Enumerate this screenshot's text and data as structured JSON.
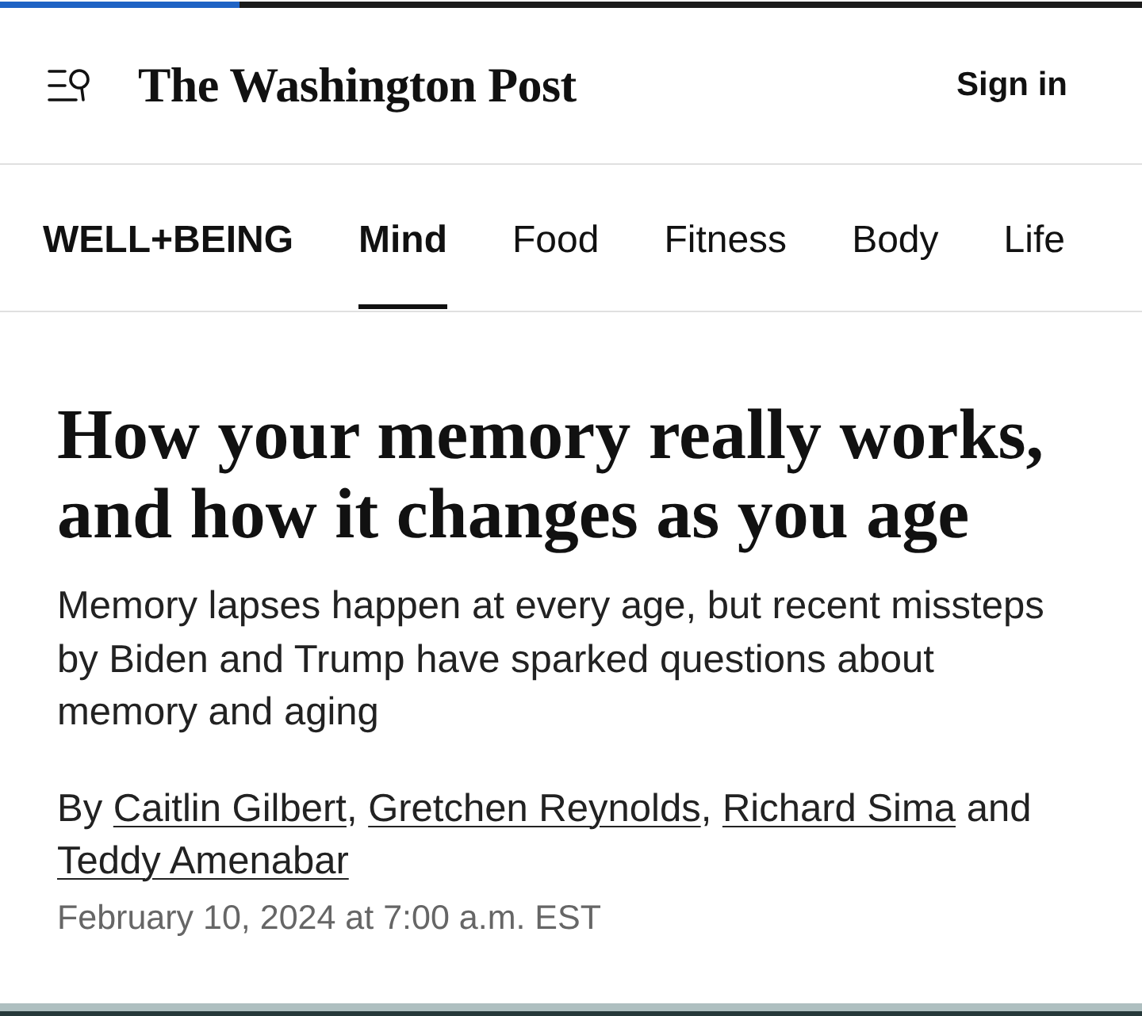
{
  "progress_bar": {
    "level": 0.21
  },
  "header": {
    "logo": "The Washington Post",
    "sign_in": "Sign in"
  },
  "section_nav": {
    "section": "WELL+BEING",
    "tabs": [
      {
        "label": "Mind",
        "selected": true
      },
      {
        "label": "Food",
        "selected": false
      },
      {
        "label": "Fitness",
        "selected": false
      },
      {
        "label": "Body",
        "selected": false
      },
      {
        "label": "Life",
        "selected": false
      }
    ]
  },
  "article": {
    "headline": "How your memory really works, and how it changes as you age",
    "subheadline": "Memory lapses happen at every age, but recent missteps by Biden and Trump have sparked questions about memory and aging",
    "byline": [
      {
        "kind": "text",
        "text": "By "
      },
      {
        "kind": "link",
        "text": "Caitlin Gilbert"
      },
      {
        "kind": "text",
        "text": ", "
      },
      {
        "kind": "link",
        "text": "Gretchen Reynolds"
      },
      {
        "kind": "text",
        "text": ", "
      },
      {
        "kind": "link",
        "text": "Richard Sima"
      },
      {
        "kind": "text",
        "text": " and "
      },
      {
        "kind": "link",
        "text": "Teddy Amenabar"
      }
    ],
    "date": "February 10, 2024 at 7:00 a.m. EST"
  }
}
